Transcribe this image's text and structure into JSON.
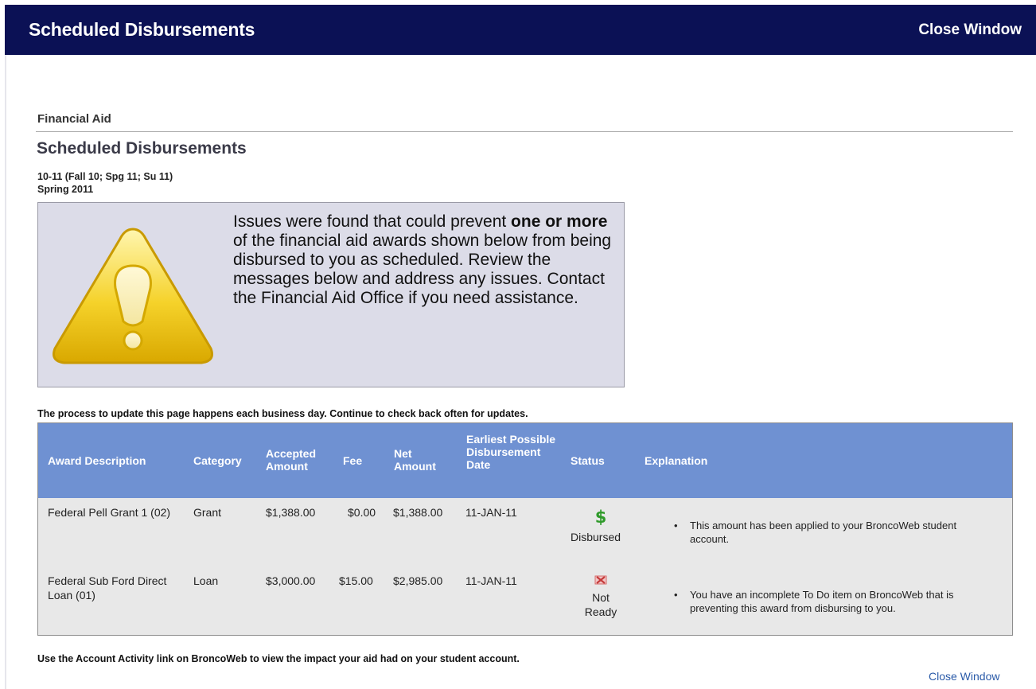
{
  "window": {
    "title": "Scheduled Disbursements",
    "close_label": "Close Window"
  },
  "section_label": "Financial Aid",
  "page_heading": "Scheduled Disbursements",
  "aid_year": "10-11 (Fall 10; Spg 11; Su 11)",
  "term": "Spring 2011",
  "alert": {
    "icon": "warning-triangle-icon",
    "text_before": "Issues were found that could prevent ",
    "text_bold": "one or more",
    "text_after": " of the financial aid awards shown below from being disbursed to you as scheduled. Review the messages below and address any issues. Contact the Financial Aid Office if you need assistance."
  },
  "process_note": "The process to update this page happens each business day. Continue to check back often for updates.",
  "table": {
    "headers": {
      "award_description": "Award Description",
      "category": "Category",
      "accepted_amount": "Accepted Amount",
      "fee": "Fee",
      "net_amount": "Net Amount",
      "earliest_date": "Earliest Possible Disbursement Date",
      "status": "Status",
      "explanation": "Explanation"
    },
    "rows": [
      {
        "award_description": "Federal Pell Grant 1 (02)",
        "category": "Grant",
        "accepted_amount": "$1,388.00",
        "fee": "$0.00",
        "net_amount": "$1,388.00",
        "earliest_date": "11-JAN-11",
        "status_icon": "dollar-icon",
        "status": "Disbursed",
        "explanation": "This amount has been applied to your BroncoWeb student account."
      },
      {
        "award_description": "Federal Sub Ford Direct Loan (01)",
        "category": "Loan",
        "accepted_amount": "$3,000.00",
        "fee": "$15.00",
        "net_amount": "$2,985.00",
        "earliest_date": "11-JAN-11",
        "status_icon": "x-icon",
        "status": "Not Ready",
        "explanation": "You have an incomplete To Do item on BroncoWeb that is preventing this award from disbursing to you."
      }
    ]
  },
  "footer_note": "Use the Account Activity link on BroncoWeb to view the impact your aid had on your student account.",
  "footer_close_label": "Close Window",
  "colors": {
    "header_bar": "#0b1155",
    "table_header": "#6f91d2",
    "alert_bg": "#dcdce8",
    "link": "#2a5aa8",
    "dollar_green": "#2f9a2a",
    "x_red": "#d66a6a"
  }
}
